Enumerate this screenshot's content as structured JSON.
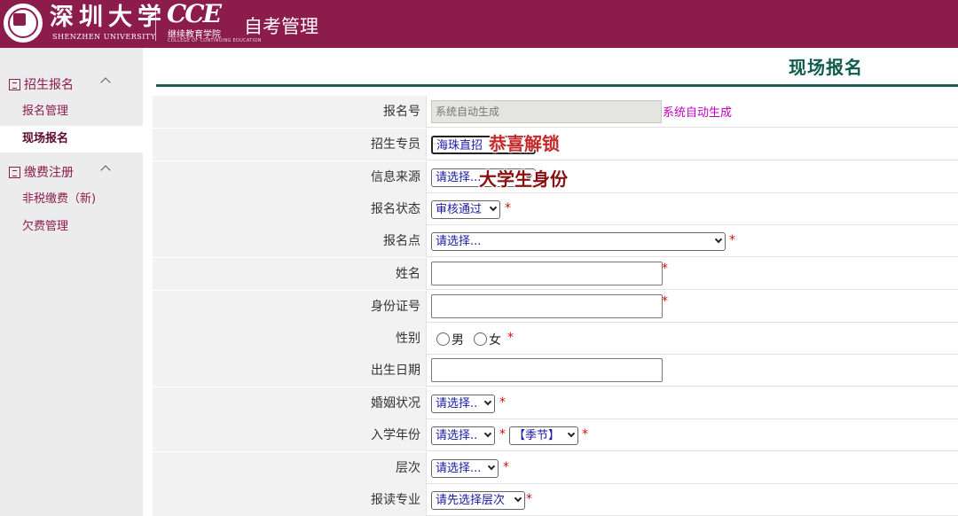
{
  "header": {
    "university_cn": "深圳大学",
    "university_en": "SHENZHEN UNIVERSITY",
    "college_logo": "CCE",
    "college_cn": "继续教育学院",
    "college_en_tiny": "COLLEGE OF CONTINUING EDUCATION",
    "app_title": "自考管理"
  },
  "sidebar": {
    "groups": [
      {
        "label": "招生报名",
        "icon": "document-icon",
        "items": [
          {
            "label": "报名管理",
            "active": false
          },
          {
            "label": "现场报名",
            "active": true
          }
        ]
      },
      {
        "label": "缴费注册",
        "icon": "ledger-icon",
        "items": [
          {
            "label": "非税缴费（新)",
            "active": false
          },
          {
            "label": "欠费管理",
            "active": false
          }
        ]
      }
    ]
  },
  "page": {
    "title": "现场报名"
  },
  "form": {
    "fields": [
      {
        "label": "报名号",
        "value": "系统自动生成",
        "note": "系统自动生成"
      },
      {
        "label": "招生专员",
        "value": "海珠直招"
      },
      {
        "label": "信息来源",
        "value": "请选择..."
      },
      {
        "label": "报名状态",
        "value": "审核通过",
        "required": "*"
      },
      {
        "label": "报名点",
        "value": "请选择...",
        "required": "*"
      },
      {
        "label": "姓名",
        "value": "",
        "required": "*"
      },
      {
        "label": "身份证号",
        "value": "",
        "required": "*"
      },
      {
        "label": "性别",
        "options": [
          "男",
          "女"
        ],
        "required": "*"
      },
      {
        "label": "出生日期",
        "value": ""
      },
      {
        "label": "婚姻状况",
        "value": "请选择..",
        "required": "*"
      },
      {
        "label": "入学年份",
        "value": "请选择..",
        "season": "【季节】",
        "required": "*"
      },
      {
        "label": "层次",
        "value": "请选择...",
        "required": "*"
      },
      {
        "label": "报读专业",
        "value": "请先选择层次",
        "required": "*"
      }
    ]
  },
  "overlay": {
    "line1": "恭喜解锁",
    "line2": "大学生身份"
  },
  "colors": {
    "brand": "#8c1c4c",
    "title_green": "#0f5c4d",
    "link_blue": "#1a1aa6",
    "required_red": "#d01010",
    "note_magenta": "#c000c0"
  }
}
